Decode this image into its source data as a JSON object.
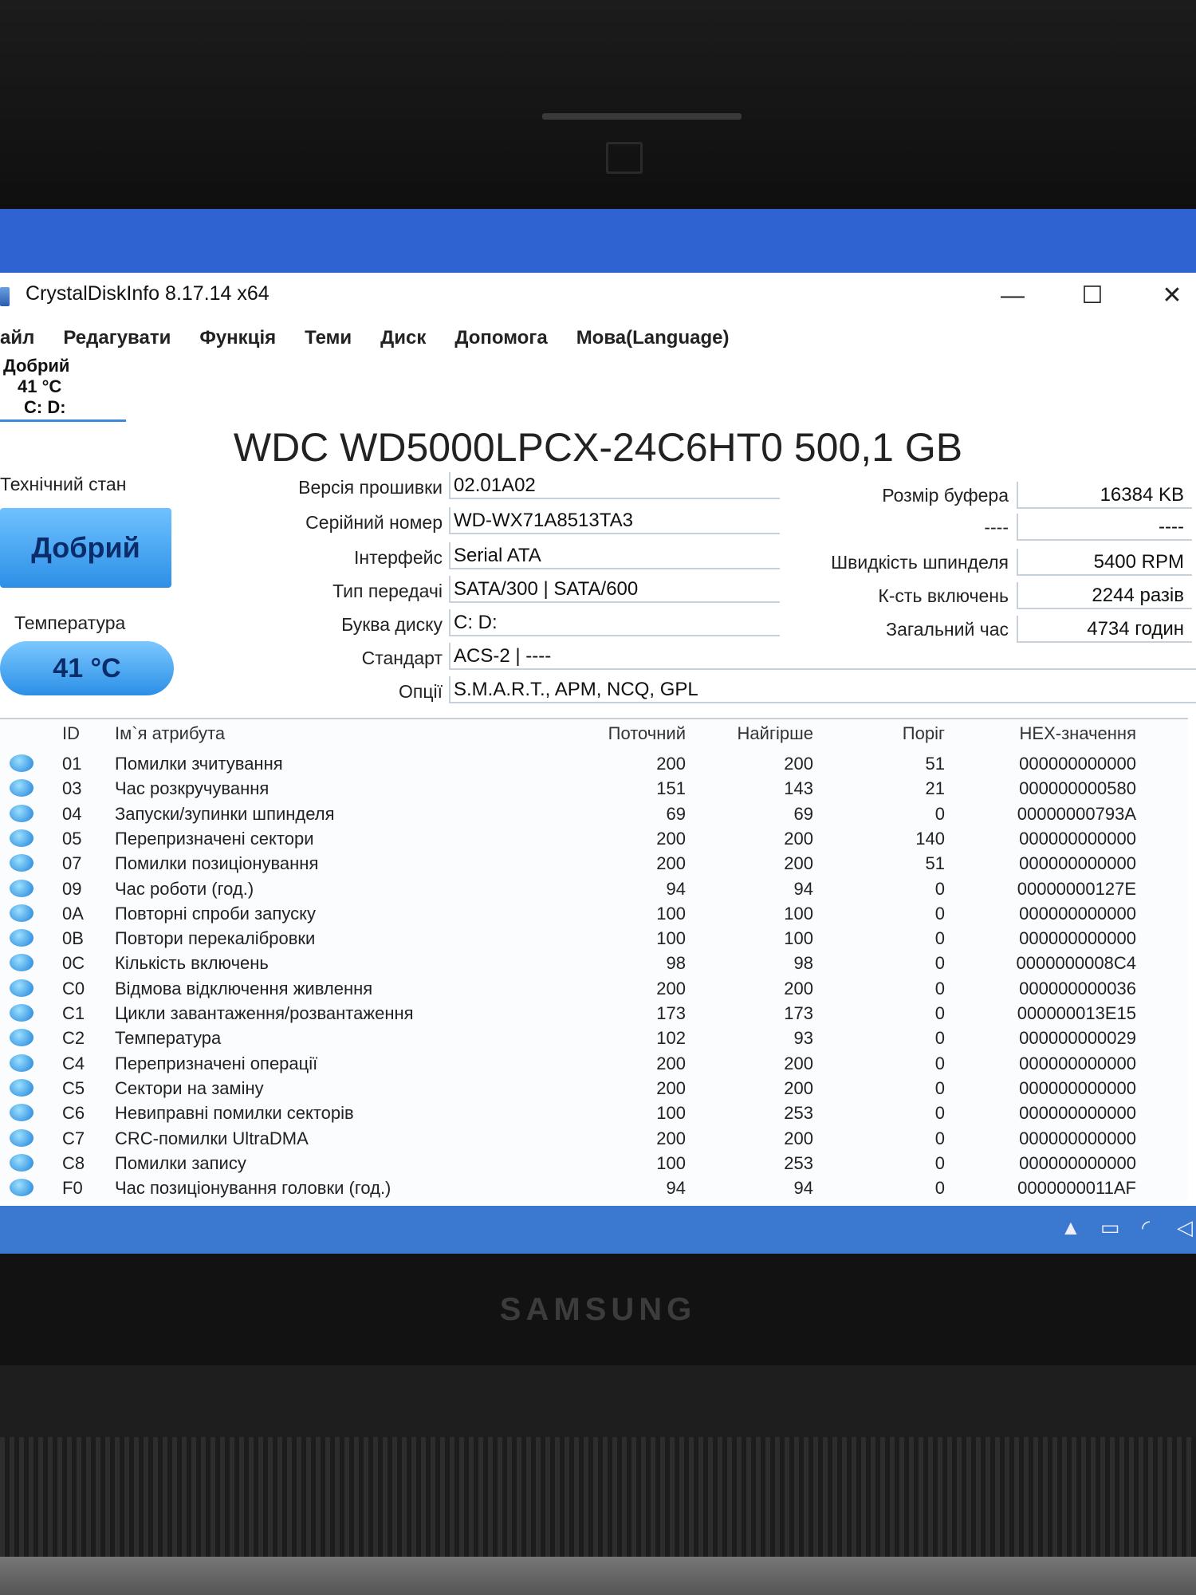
{
  "window": {
    "title": "CrystalDiskInfo 8.17.14 x64",
    "controls": {
      "minimize": "—",
      "maximize": "☐",
      "close": "✕"
    }
  },
  "menu": [
    "айл",
    "Редагувати",
    "Функція",
    "Теми",
    "Диск",
    "Допомога",
    "Мова(Language)"
  ],
  "drive_tab": {
    "status": "Добрий",
    "temp": "41 °C",
    "letters": "C: D:"
  },
  "disk": {
    "title": "WDC WD5000LPCX-24C6HT0 500,1 GB",
    "health_label": "Технічний стан",
    "health_value": "Добрий",
    "temp_label": "Температура",
    "temp_value": "41 °C"
  },
  "info_left": [
    {
      "label": "Версія прошивки",
      "value": "02.01A02"
    },
    {
      "label": "Серійний номер",
      "value": "WD-WX71A8513TA3"
    },
    {
      "label": "Інтерфейс",
      "value": "Serial ATA"
    },
    {
      "label": "Тип передачі",
      "value": "SATA/300 | SATA/600"
    },
    {
      "label": "Буква диску",
      "value": "C: D:"
    },
    {
      "label": "Стандарт",
      "value": "ACS-2 | ----"
    },
    {
      "label": "Опції",
      "value": "S.M.A.R.T., APM, NCQ, GPL"
    }
  ],
  "info_right": [
    {
      "label": "Розмір буфера",
      "value": "16384 KB"
    },
    {
      "label": "----",
      "value": "----"
    },
    {
      "label": "Швидкість шпинделя",
      "value": "5400 RPM"
    },
    {
      "label": "К-сть включень",
      "value": "2244 разів"
    },
    {
      "label": "Загальний час",
      "value": "4734 годин"
    }
  ],
  "smart_headers": [
    "ID",
    "Ім`я атрибута",
    "Поточний",
    "Найгірше",
    "Поріг",
    "HEX-значення"
  ],
  "smart_rows": [
    {
      "id": "01",
      "name": "Помилки зчитування",
      "cur": "200",
      "worst": "200",
      "thr": "51",
      "hex": "000000000000"
    },
    {
      "id": "03",
      "name": "Час розкручування",
      "cur": "151",
      "worst": "143",
      "thr": "21",
      "hex": "000000000580"
    },
    {
      "id": "04",
      "name": "Запуски/зупинки шпинделя",
      "cur": "69",
      "worst": "69",
      "thr": "0",
      "hex": "00000000793A"
    },
    {
      "id": "05",
      "name": "Перепризначені сектори",
      "cur": "200",
      "worst": "200",
      "thr": "140",
      "hex": "000000000000"
    },
    {
      "id": "07",
      "name": "Помилки позиціонування",
      "cur": "200",
      "worst": "200",
      "thr": "51",
      "hex": "000000000000"
    },
    {
      "id": "09",
      "name": "Час роботи (год.)",
      "cur": "94",
      "worst": "94",
      "thr": "0",
      "hex": "00000000127E"
    },
    {
      "id": "0A",
      "name": "Повторні спроби запуску",
      "cur": "100",
      "worst": "100",
      "thr": "0",
      "hex": "000000000000"
    },
    {
      "id": "0B",
      "name": "Повтори перекалібровки",
      "cur": "100",
      "worst": "100",
      "thr": "0",
      "hex": "000000000000"
    },
    {
      "id": "0C",
      "name": "Кількість включень",
      "cur": "98",
      "worst": "98",
      "thr": "0",
      "hex": "0000000008C4"
    },
    {
      "id": "C0",
      "name": "Відмова відключення живлення",
      "cur": "200",
      "worst": "200",
      "thr": "0",
      "hex": "000000000036"
    },
    {
      "id": "C1",
      "name": "Цикли завантаження/розвантаження",
      "cur": "173",
      "worst": "173",
      "thr": "0",
      "hex": "000000013E15"
    },
    {
      "id": "C2",
      "name": "Температура",
      "cur": "102",
      "worst": "93",
      "thr": "0",
      "hex": "000000000029"
    },
    {
      "id": "C4",
      "name": "Перепризначені операції",
      "cur": "200",
      "worst": "200",
      "thr": "0",
      "hex": "000000000000"
    },
    {
      "id": "C5",
      "name": "Сектори на заміну",
      "cur": "200",
      "worst": "200",
      "thr": "0",
      "hex": "000000000000"
    },
    {
      "id": "C6",
      "name": "Невиправні помилки секторів",
      "cur": "100",
      "worst": "253",
      "thr": "0",
      "hex": "000000000000"
    },
    {
      "id": "C7",
      "name": "CRC-помилки UltraDMA",
      "cur": "200",
      "worst": "200",
      "thr": "0",
      "hex": "000000000000"
    },
    {
      "id": "C8",
      "name": "Помилки запису",
      "cur": "100",
      "worst": "253",
      "thr": "0",
      "hex": "000000000000"
    },
    {
      "id": "F0",
      "name": "Час позиціонування головки (год.)",
      "cur": "94",
      "worst": "94",
      "thr": "0",
      "hex": "0000000011AF"
    }
  ],
  "laptop_brand": "SAMSUNG",
  "colors": {
    "accent": "#2c8fe6",
    "desktop": "#2f63d1",
    "taskbar": "#3b78d0"
  }
}
